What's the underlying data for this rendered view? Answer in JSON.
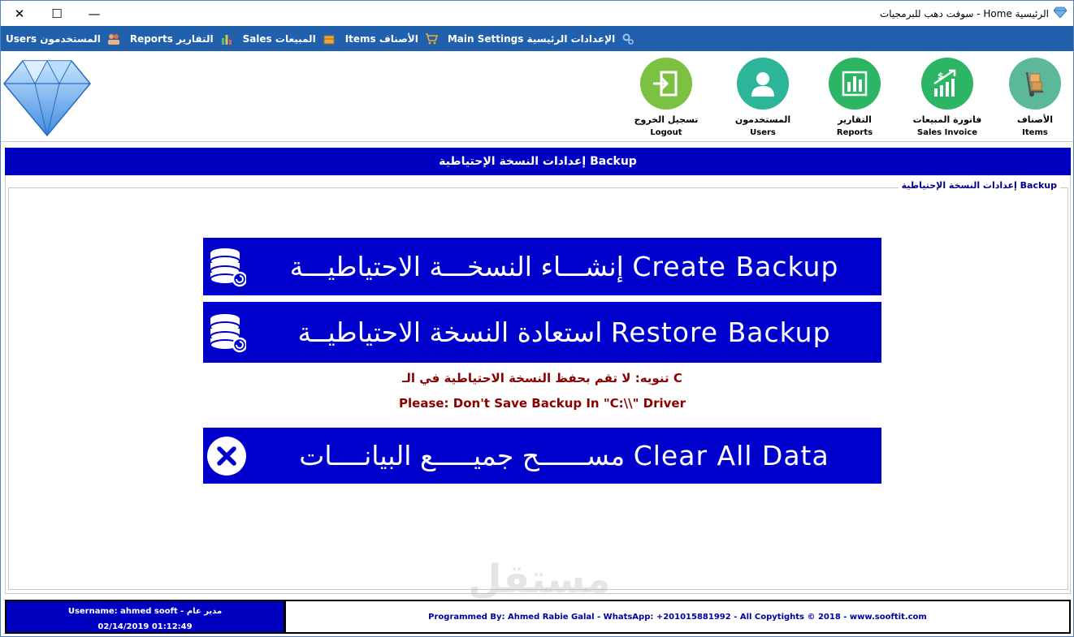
{
  "window": {
    "title": "الرئيسية Home - سوفت دهب للبرمجيات",
    "buttons": {
      "minimize": "—",
      "maximize": "☐",
      "close": "✕"
    }
  },
  "menubar": {
    "items": [
      {
        "label": "الإعدادات الرئيسية Main Settings",
        "icon": "settings-gear-icon"
      },
      {
        "label": "الأصناف Items",
        "icon": "cart-icon"
      },
      {
        "label": "المبيعات Sales",
        "icon": "box-icon"
      },
      {
        "label": "التقارير Reports",
        "icon": "reports-icon"
      },
      {
        "label": "المستخدمون Users",
        "icon": "users-icon"
      }
    ]
  },
  "toolbar": {
    "items": [
      {
        "ar": "الأصناف",
        "en": "Items",
        "color": "#5bb899"
      },
      {
        "ar": "فاتورة المبيعات",
        "en": "Sales Invoice",
        "color": "#2db566"
      },
      {
        "ar": "التقارير",
        "en": "Reports",
        "color": "#2db566"
      },
      {
        "ar": "المستخدمون",
        "en": "Users",
        "color": "#2db59a"
      },
      {
        "ar": "تسجيل الخروج",
        "en": "Logout",
        "color": "#7dc143"
      }
    ]
  },
  "section": {
    "header": "إعدادات النسخة الإحتياطية Backup",
    "groupbox_title": "إعدادات النسخة الإحتياطية Backup"
  },
  "actions": {
    "create_backup": "إنشـــاء النسخـــة الاحتياطيـــة Create Backup",
    "restore_backup": "استعادة النسخة الاحتياطيــة Restore Backup",
    "clear_all_data": "مســــــح جميـــــع البيانــــات Clear All Data"
  },
  "notice": {
    "arabic": "تنويه: لا تقم بحفظ النسخة الاحتياطية في الـ C",
    "english": "Please: Don't Save Backup In \"C:\\\\\" Driver"
  },
  "status": {
    "username_line": "Username: ahmed sooft - مدير عام",
    "datetime": "02/14/2019 01:12:49",
    "credits": "Programmed By: Ahmed Rabie Galal - WhatsApp: +201015881992 - All Copytights © 2018 - www.sooftit.com"
  },
  "watermark": "مستقل",
  "colors": {
    "menubar": "#2060ac",
    "primary_button": "#0000cc",
    "section_header": "#0000c0",
    "notice_text": "#8b0000"
  }
}
